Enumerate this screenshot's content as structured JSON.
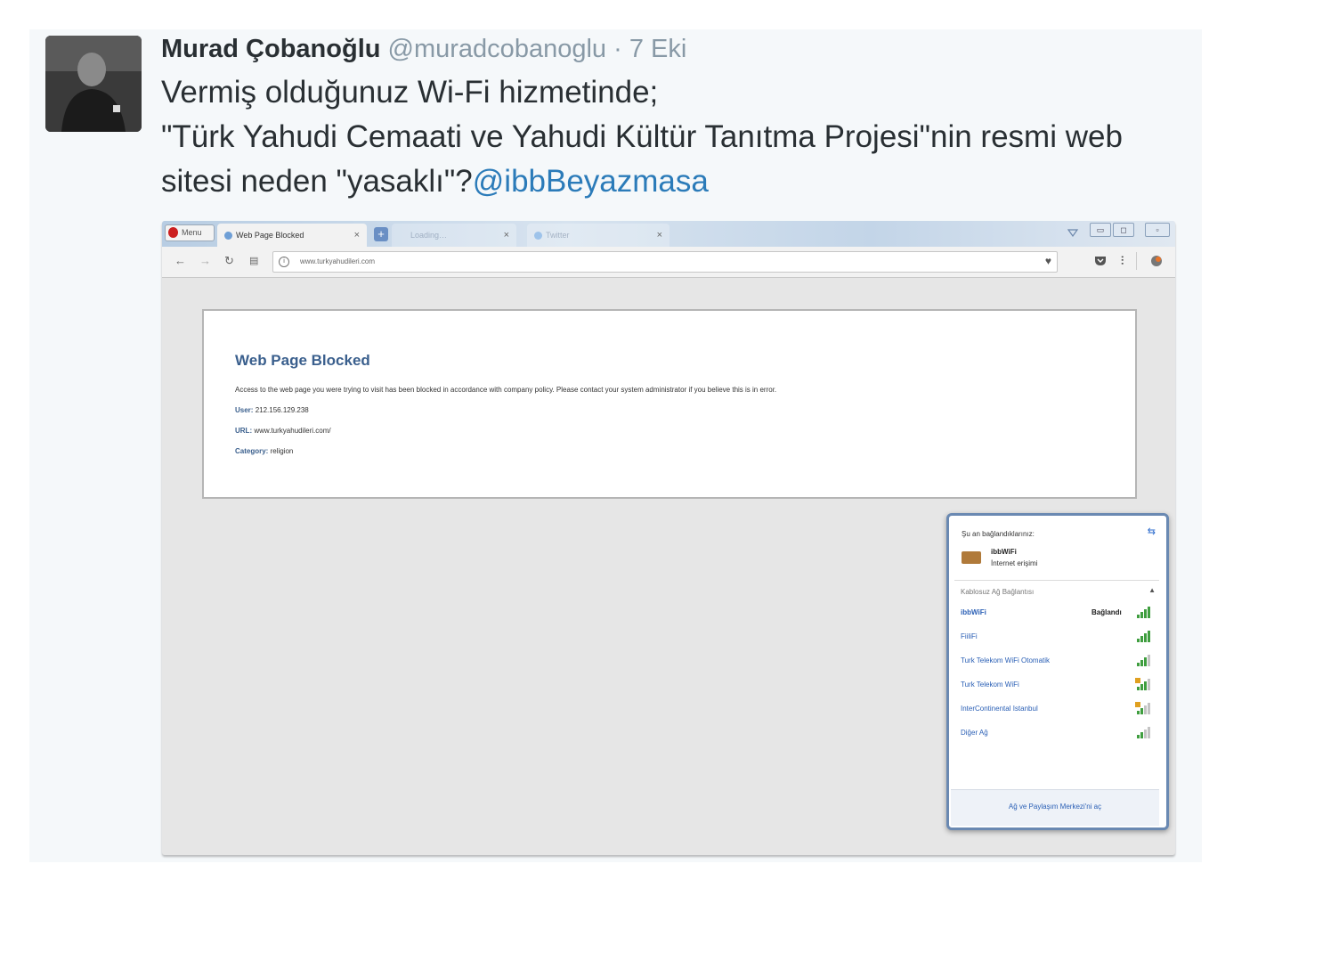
{
  "tweet": {
    "author_name": "Murad Çobanoğlu",
    "handle": "@muradcobanoglu",
    "date_sep": " · ",
    "date": "7 Eki",
    "text_line1": "Vermiş olduğunuz Wi-Fi hizmetinde;",
    "text_line2": "\"Türk Yahudi Cemaati ve Yahudi Kültür Tanıtma Projesi\"nin resmi web sitesi neden \"yasaklı\"?",
    "mention": "@ibbBeyazmasa"
  },
  "browser": {
    "menu_label": "Menu",
    "active_tab_title": "Web Page Blocked",
    "tab2_title": "Loading…",
    "tab3_title": "Twitter",
    "close_glyph": "×",
    "newtab_glyph": "+",
    "url": "www.turkyahudileri.com",
    "icons": {
      "back": "back-arrow-icon",
      "forward": "forward-arrow-icon",
      "reload": "reload-icon",
      "tabs": "speed-dial-icon",
      "info": "info-icon"
    }
  },
  "blocked_page": {
    "title": "Web Page Blocked",
    "message": "Access to the web page you were trying to visit has been blocked in accordance with company policy. Please contact your system administrator if you believe this is in error.",
    "user_label": "User:",
    "user_value": "212.156.129.238",
    "url_label": "URL:",
    "url_value": "www.turkyahudileri.com/",
    "category_label": "Category:",
    "category_value": "religion"
  },
  "wifi_popup": {
    "heading": "Şu an bağlandıklarınız:",
    "connected_network": "ibbWiFi",
    "connected_status": "İnternet erişimi",
    "section_label": "Kablosuz Ağ Bağlantısı",
    "networks": [
      {
        "name": "ibbWiFi",
        "status": "Bağlandı",
        "signal": 4,
        "secured": false
      },
      {
        "name": "FiiliFi",
        "status": "",
        "signal": 4,
        "secured": false
      },
      {
        "name": "Turk Telekom WiFi Otomatik",
        "status": "",
        "signal": 3,
        "secured": false
      },
      {
        "name": "Turk Telekom WiFi",
        "status": "",
        "signal": 3,
        "secured": true
      },
      {
        "name": "InterContinental Istanbul",
        "status": "",
        "signal": 2,
        "secured": true
      },
      {
        "name": "Diğer Ağ",
        "status": "",
        "signal": 2,
        "secured": false
      }
    ],
    "footer_link": "Ağ ve Paylaşım Merkezi'ni aç",
    "colors": {
      "signal_on": "#3f9e3f",
      "signal_off": "#c4c4c4",
      "secured": "#e0a020"
    }
  }
}
